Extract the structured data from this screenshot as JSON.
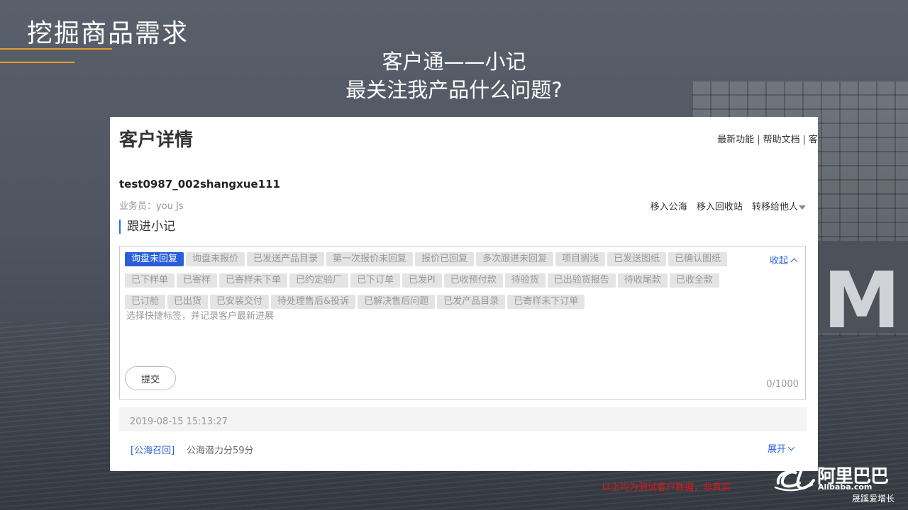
{
  "slide": {
    "title": "挖掘商品需求",
    "subtitle_line1": "客户通——小记",
    "subtitle_line2": "最关注我产品什么问题?",
    "accent_color": "#e59b2c"
  },
  "panel": {
    "title": "客户详情",
    "top_links": [
      "最新功能",
      "帮助文档",
      "客"
    ],
    "customer_name": "test0987_002shangxue111",
    "sales_rep": "业务员：you Js",
    "actions": [
      "移入公海",
      "移入回收站",
      "转移给他人"
    ],
    "section_title": "跟进小记"
  },
  "editor": {
    "tags": [
      "询盘未回复",
      "询盘未报价",
      "已发送产品目录",
      "第一次报价未回复",
      "报价已回复",
      "多次跟进未回复",
      "项目搁浅",
      "已发送图纸",
      "已确认图纸",
      "已下样单",
      "已寄样",
      "已寄样未下单",
      "已约定验厂",
      "已下订单",
      "已发PI",
      "已收预付款",
      "待验货",
      "已出验货报告",
      "待收尾款",
      "已收全款",
      "已订舱",
      "已出货",
      "已安装交付",
      "待处理售后&投诉",
      "已解决售后问题",
      "已发产品目录",
      "已寄样未下订单"
    ],
    "active_tag": "询盘未回复",
    "collapse_label": "收起",
    "placeholder": "选择快捷标签，并记录客户最新进展",
    "value": "",
    "submit_label": "提交",
    "counter": "0/1000",
    "active_color": "#2b5fd9"
  },
  "record": {
    "timestamp": "2019-08-15 15:13:27",
    "tag": "[公海召回]",
    "text": "公海潜力分59分",
    "expand_label": "展开"
  },
  "footer": {
    "disclaimer": "以上均为测试客户数据，非真实",
    "logo_cn": "阿里巴巴",
    "logo_en": "Alibaba.com",
    "slogan": "晟蹊爱增长"
  },
  "icons": [
    "chevron-up-icon",
    "chevron-down-icon",
    "caret-down-icon",
    "alibaba-logo-icon"
  ]
}
